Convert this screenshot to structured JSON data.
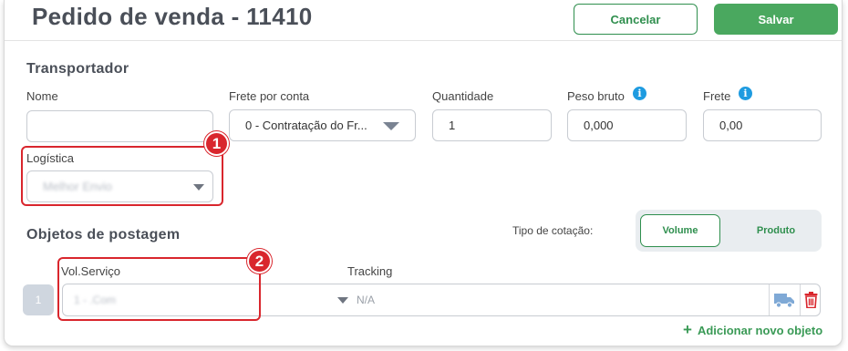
{
  "header": {
    "title": "Pedido de venda - 11410",
    "cancel_label": "Cancelar",
    "save_label": "Salvar"
  },
  "transportador": {
    "section_title": "Transportador",
    "nome": {
      "label": "Nome",
      "value": ""
    },
    "frete_por_conta": {
      "label": "Frete por conta",
      "value": "0 - Contratação do Fr..."
    },
    "quantidade": {
      "label": "Quantidade",
      "value": "1"
    },
    "peso_bruto": {
      "label": "Peso bruto",
      "value": "0,000"
    },
    "frete": {
      "label": "Frete",
      "value": "0,00"
    },
    "logistica": {
      "label": "Logística",
      "value": "Melhor Envio"
    }
  },
  "objetos": {
    "section_title": "Objetos de postagem",
    "tipo_cotacao_label": "Tipo de cotação:",
    "tipo_cotacao_options": [
      "Volume",
      "Produto"
    ],
    "tipo_cotacao_selected": "Volume",
    "columns": {
      "vol_servico": "Vol.Serviço",
      "tracking": "Tracking"
    },
    "rows": [
      {
        "index": "1",
        "vol_servico": "1 - .Com",
        "tracking": "N/A"
      }
    ],
    "add_label": "Adicionar novo objeto"
  },
  "annotations": [
    "1",
    "2"
  ],
  "colors": {
    "accent_green": "#4aa85f",
    "highlight_red": "#d9262d",
    "info_blue": "#1e9be0",
    "delete_red": "#d9262d",
    "truck_blue": "#7fa9d6"
  },
  "icons": [
    "info-icon",
    "chevron-down-icon",
    "truck-icon",
    "trash-icon",
    "plus-icon"
  ]
}
